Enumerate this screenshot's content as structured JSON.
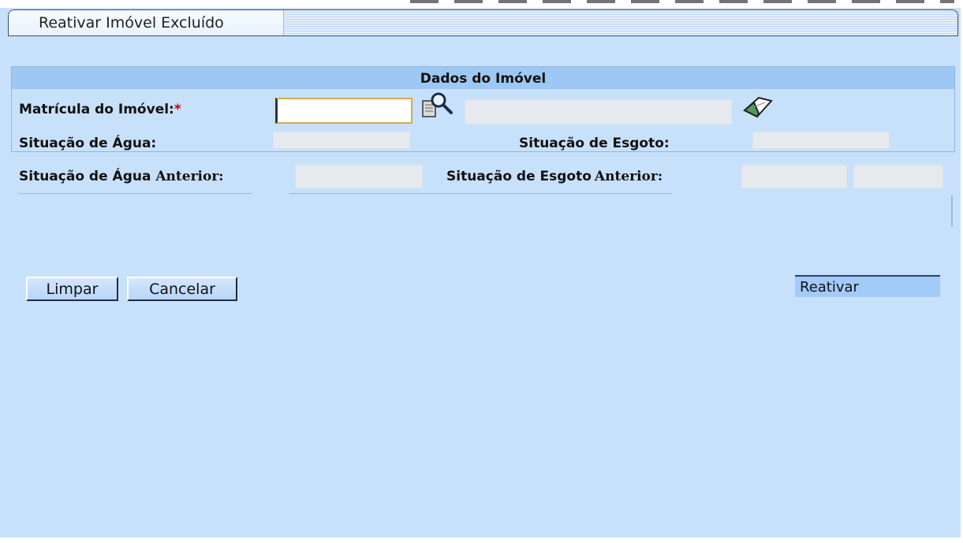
{
  "window": {
    "title": "Reativar Imóvel Excluído"
  },
  "section": {
    "header": "Dados do Imóvel"
  },
  "fields": {
    "matricula_label": "Matrícula do Imóvel:",
    "required_mark": "*",
    "matricula_value": "",
    "situacao_agua_label": "Situação de Água:",
    "situacao_esgoto_label": "Situação de Esgoto:",
    "situacao_agua_anterior_prefix": "Situação de Água ",
    "situacao_esgoto_anterior_prefix": "Situação de Esgoto",
    "anterior_word": "Anterior:"
  },
  "buttons": {
    "limpar": "Limpar",
    "cancelar": "Cancelar",
    "reativar": "Reativar"
  },
  "icons": {
    "search": "search-icon",
    "eraser": "eraser-icon"
  }
}
